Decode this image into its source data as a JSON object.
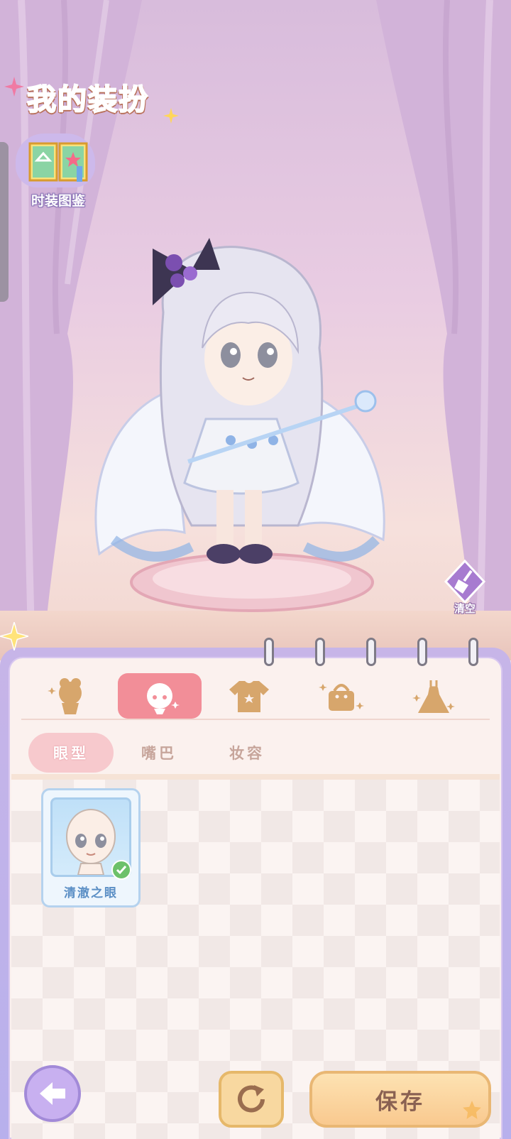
{
  "header": {
    "title": "我的装扮"
  },
  "album": {
    "label": "时装图鉴",
    "icon": "book-icon"
  },
  "stage": {
    "clear_label": "清空",
    "clear_icon": "broom-icon"
  },
  "category_tabs": [
    {
      "name": "hair",
      "icon": "hair-silhouette-icon",
      "active": false
    },
    {
      "name": "face",
      "icon": "face-icon",
      "active": true
    },
    {
      "name": "clothes",
      "icon": "shirt-icon",
      "active": false
    },
    {
      "name": "bag",
      "icon": "handbag-icon",
      "active": false
    },
    {
      "name": "dress",
      "icon": "dress-icon",
      "active": false
    }
  ],
  "sub_tabs": [
    {
      "label": "眼型",
      "active": true
    },
    {
      "label": "嘴巴",
      "active": false
    },
    {
      "label": "妆容",
      "active": false
    }
  ],
  "items": [
    {
      "name": "清澈之眼",
      "selected": true
    }
  ],
  "footer": {
    "back_icon": "arrow-left-icon",
    "refresh_icon": "refresh-icon",
    "save_label": "保存"
  },
  "colors": {
    "accent_pink": "#f28e98",
    "panel_lilac": "#c7b5e8",
    "save_gold": "#f9c98f",
    "item_blue": "#5b8fc5"
  }
}
